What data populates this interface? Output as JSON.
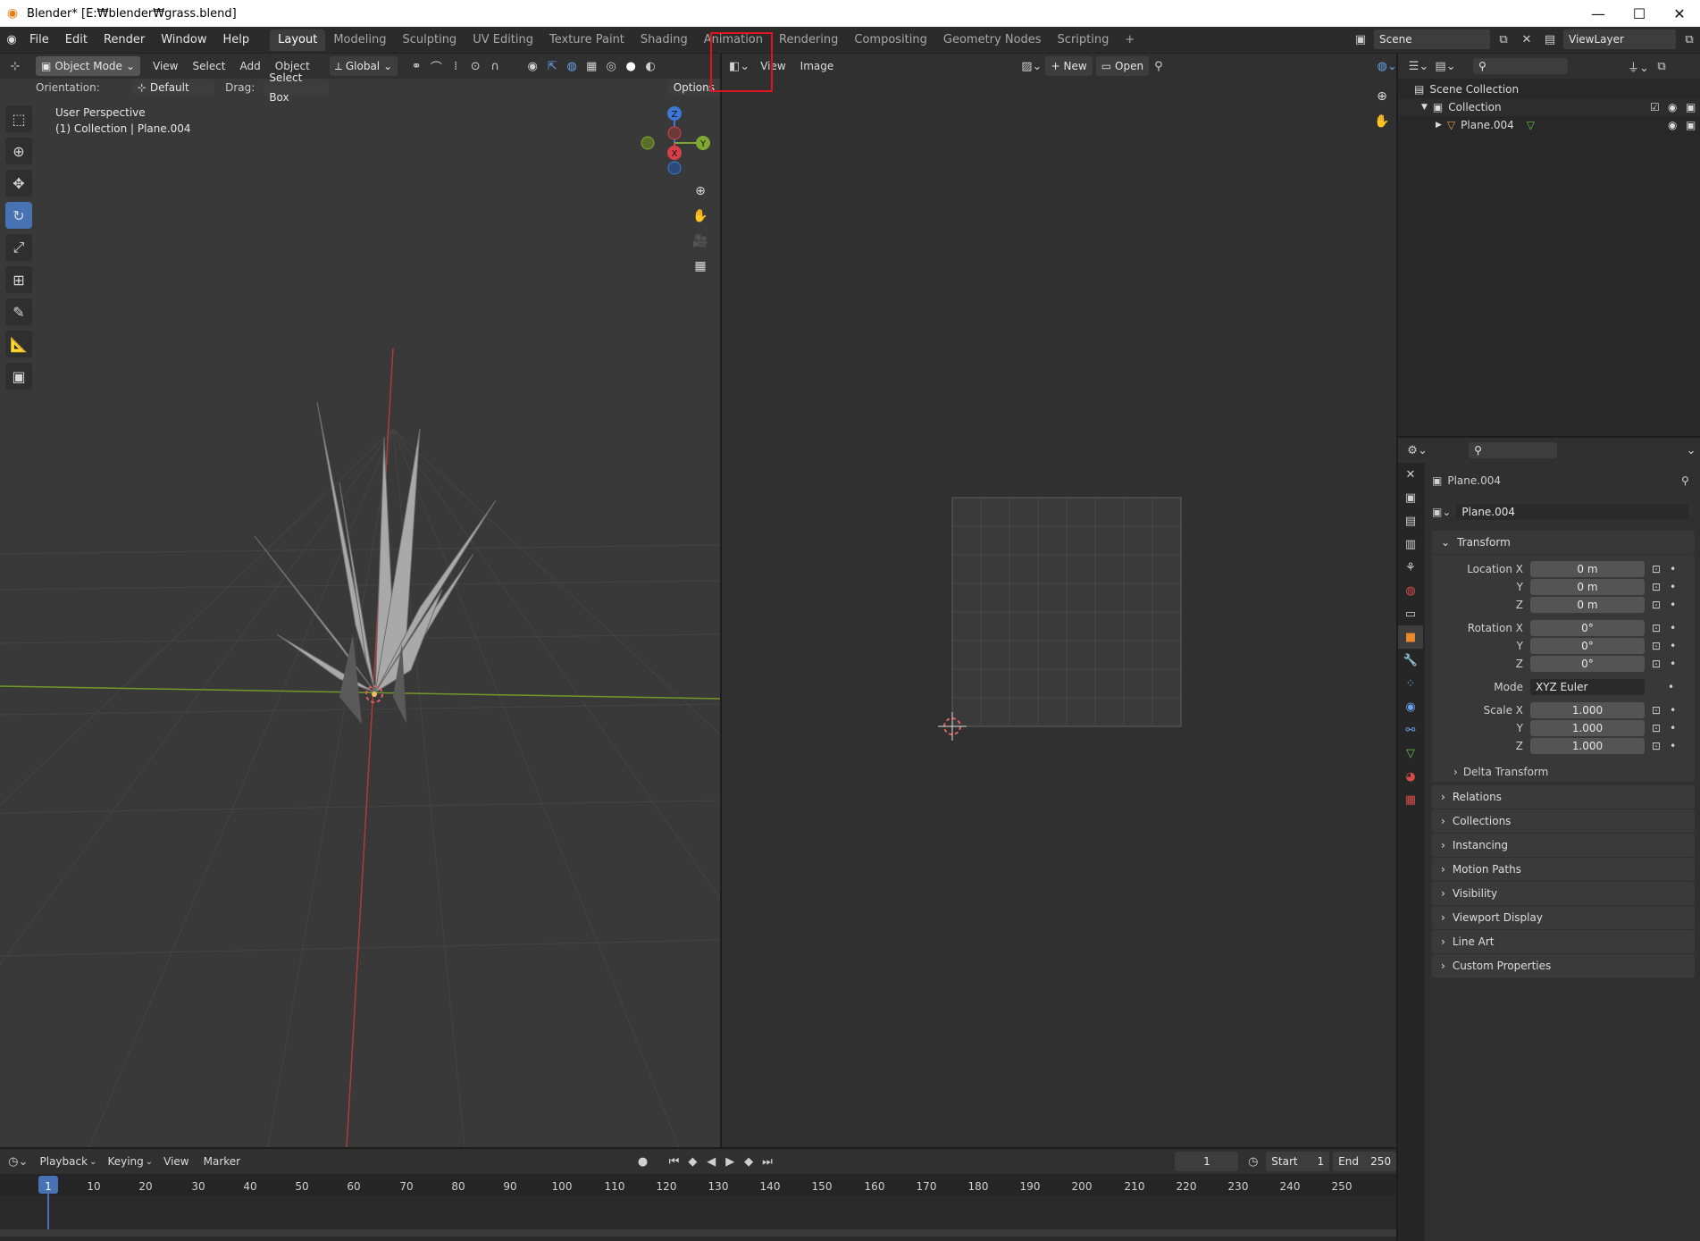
{
  "window": {
    "title": "Blender* [E:₩blender₩grass.blend]",
    "minimize": "—",
    "maximize": "☐",
    "close": "✕"
  },
  "menubar": {
    "file": "File",
    "edit": "Edit",
    "render": "Render",
    "window": "Window",
    "help": "Help",
    "tabs": [
      "Layout",
      "Modeling",
      "Sculpting",
      "UV Editing",
      "Texture Paint",
      "Shading",
      "Animation",
      "Rendering",
      "Compositing",
      "Geometry Nodes",
      "Scripting"
    ],
    "add_tab": "+",
    "scene": "Scene",
    "view_layer": "ViewLayer"
  },
  "viewport": {
    "mode": "Object Mode",
    "view": "View",
    "select": "Select",
    "add": "Add",
    "object": "Object",
    "transform_orientation": "Global",
    "orientation_label": "Orientation:",
    "orientation_value": "Default",
    "drag_label": "Drag:",
    "drag_value": "Select Box",
    "options": "Options",
    "info_line1": "User Perspective",
    "info_line2": "(1) Collection | Plane.004",
    "gizmo": {
      "x": "X",
      "y": "Y",
      "z": "Z"
    }
  },
  "image_editor": {
    "view": "View",
    "image": "Image",
    "new": "New",
    "open": "Open"
  },
  "outliner": {
    "scene_collection": "Scene Collection",
    "collection": "Collection",
    "object": "Plane.004"
  },
  "properties": {
    "object_name": "Plane.004",
    "name_field": "Plane.004",
    "transform": "Transform",
    "location_x_label": "Location X",
    "y_label": "Y",
    "z_label": "Z",
    "location": [
      "0 m",
      "0 m",
      "0 m"
    ],
    "rotation_x_label": "Rotation X",
    "rotation": [
      "0°",
      "0°",
      "0°"
    ],
    "mode_label": "Mode",
    "mode_value": "XYZ Euler",
    "scale_x_label": "Scale X",
    "scale": [
      "1.000",
      "1.000",
      "1.000"
    ],
    "delta_transform": "Delta Transform",
    "panels": [
      "Relations",
      "Collections",
      "Instancing",
      "Motion Paths",
      "Visibility",
      "Viewport Display",
      "Line Art",
      "Custom Properties"
    ]
  },
  "timeline": {
    "playback": "Playback",
    "keying": "Keying",
    "view": "View",
    "marker": "Marker",
    "current_frame": "1",
    "start_label": "Start",
    "start_value": "1",
    "end_label": "End",
    "end_value": "250",
    "ticks": [
      "1",
      "10",
      "20",
      "30",
      "40",
      "50",
      "60",
      "70",
      "80",
      "90",
      "100",
      "110",
      "120",
      "130",
      "140",
      "150",
      "160",
      "170",
      "180",
      "190",
      "200",
      "210",
      "220",
      "230",
      "240",
      "250"
    ]
  },
  "colors": {
    "accent": "#4772b3",
    "highlight_box": "#e0141e",
    "x_axis": "#b03a3a",
    "y_axis": "#6f9a2a"
  }
}
